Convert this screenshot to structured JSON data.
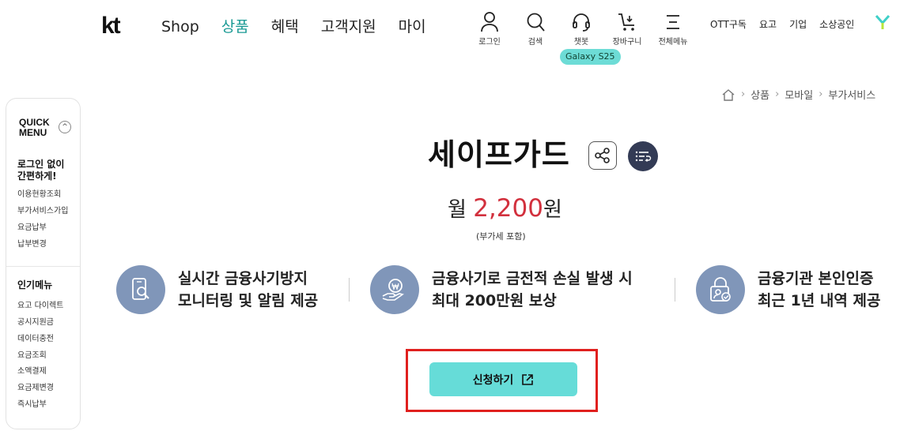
{
  "header": {
    "logo": "kt",
    "nav": [
      "Shop",
      "상품",
      "혜택",
      "고객지원",
      "마이"
    ],
    "nav_active_index": 1,
    "utility": [
      {
        "label": "로그인",
        "icon": "person-icon"
      },
      {
        "label": "검색",
        "icon": "search-icon"
      },
      {
        "label": "챗봇",
        "icon": "headset-icon"
      },
      {
        "label": "장바구니",
        "icon": "cart-icon"
      },
      {
        "label": "전체메뉴",
        "icon": "menu-icon"
      }
    ],
    "chip": "Galaxy S25",
    "right_links": [
      "OTT구독",
      "요고",
      "기업",
      "소상공인"
    ],
    "y_logo_icon": "y-brand-icon"
  },
  "quick_menu": {
    "title_line1": "QUICK",
    "title_line2": "MENU",
    "toggle": "^",
    "section1_line1": "로그인 없이",
    "section1_line2": "간편하게!",
    "section1_items": [
      "이용현황조회",
      "부가서비스가입",
      "요금납부",
      "납부변경"
    ],
    "section2_title": "인기메뉴",
    "section2_items": [
      "요고 다이렉트",
      "공시지원금",
      "데이터충전",
      "요금조회",
      "소액결제",
      "요금제변경",
      "즉시납부"
    ]
  },
  "breadcrumb": [
    "상품",
    "모바일",
    "부가서비스"
  ],
  "product": {
    "title": "세이프가드",
    "price_prefix": "월 ",
    "price_value": "2,200",
    "price_suffix": "원",
    "vat_note": "(부가세 포함)"
  },
  "features": [
    {
      "line1": "실시간  금융사기방지",
      "line2": "모니터링 및  알림 제공",
      "icon": "phone-search-icon"
    },
    {
      "line1": "금융사기로  금전적 손실  발생 시",
      "line2": "최대 200만원  보상",
      "icon": "won-coin-hand-icon"
    },
    {
      "line1": "금융기관  본인인증",
      "line2": "최근 1년 내역 제공",
      "icon": "lock-user-icon"
    }
  ],
  "cta": {
    "label": "신청하기",
    "icon": "external-link-icon"
  },
  "colors": {
    "accent": "#66dcd8",
    "price": "#d2303d",
    "feature_icon_bg": "#8096b9",
    "highlight_frame": "#e0201e"
  }
}
